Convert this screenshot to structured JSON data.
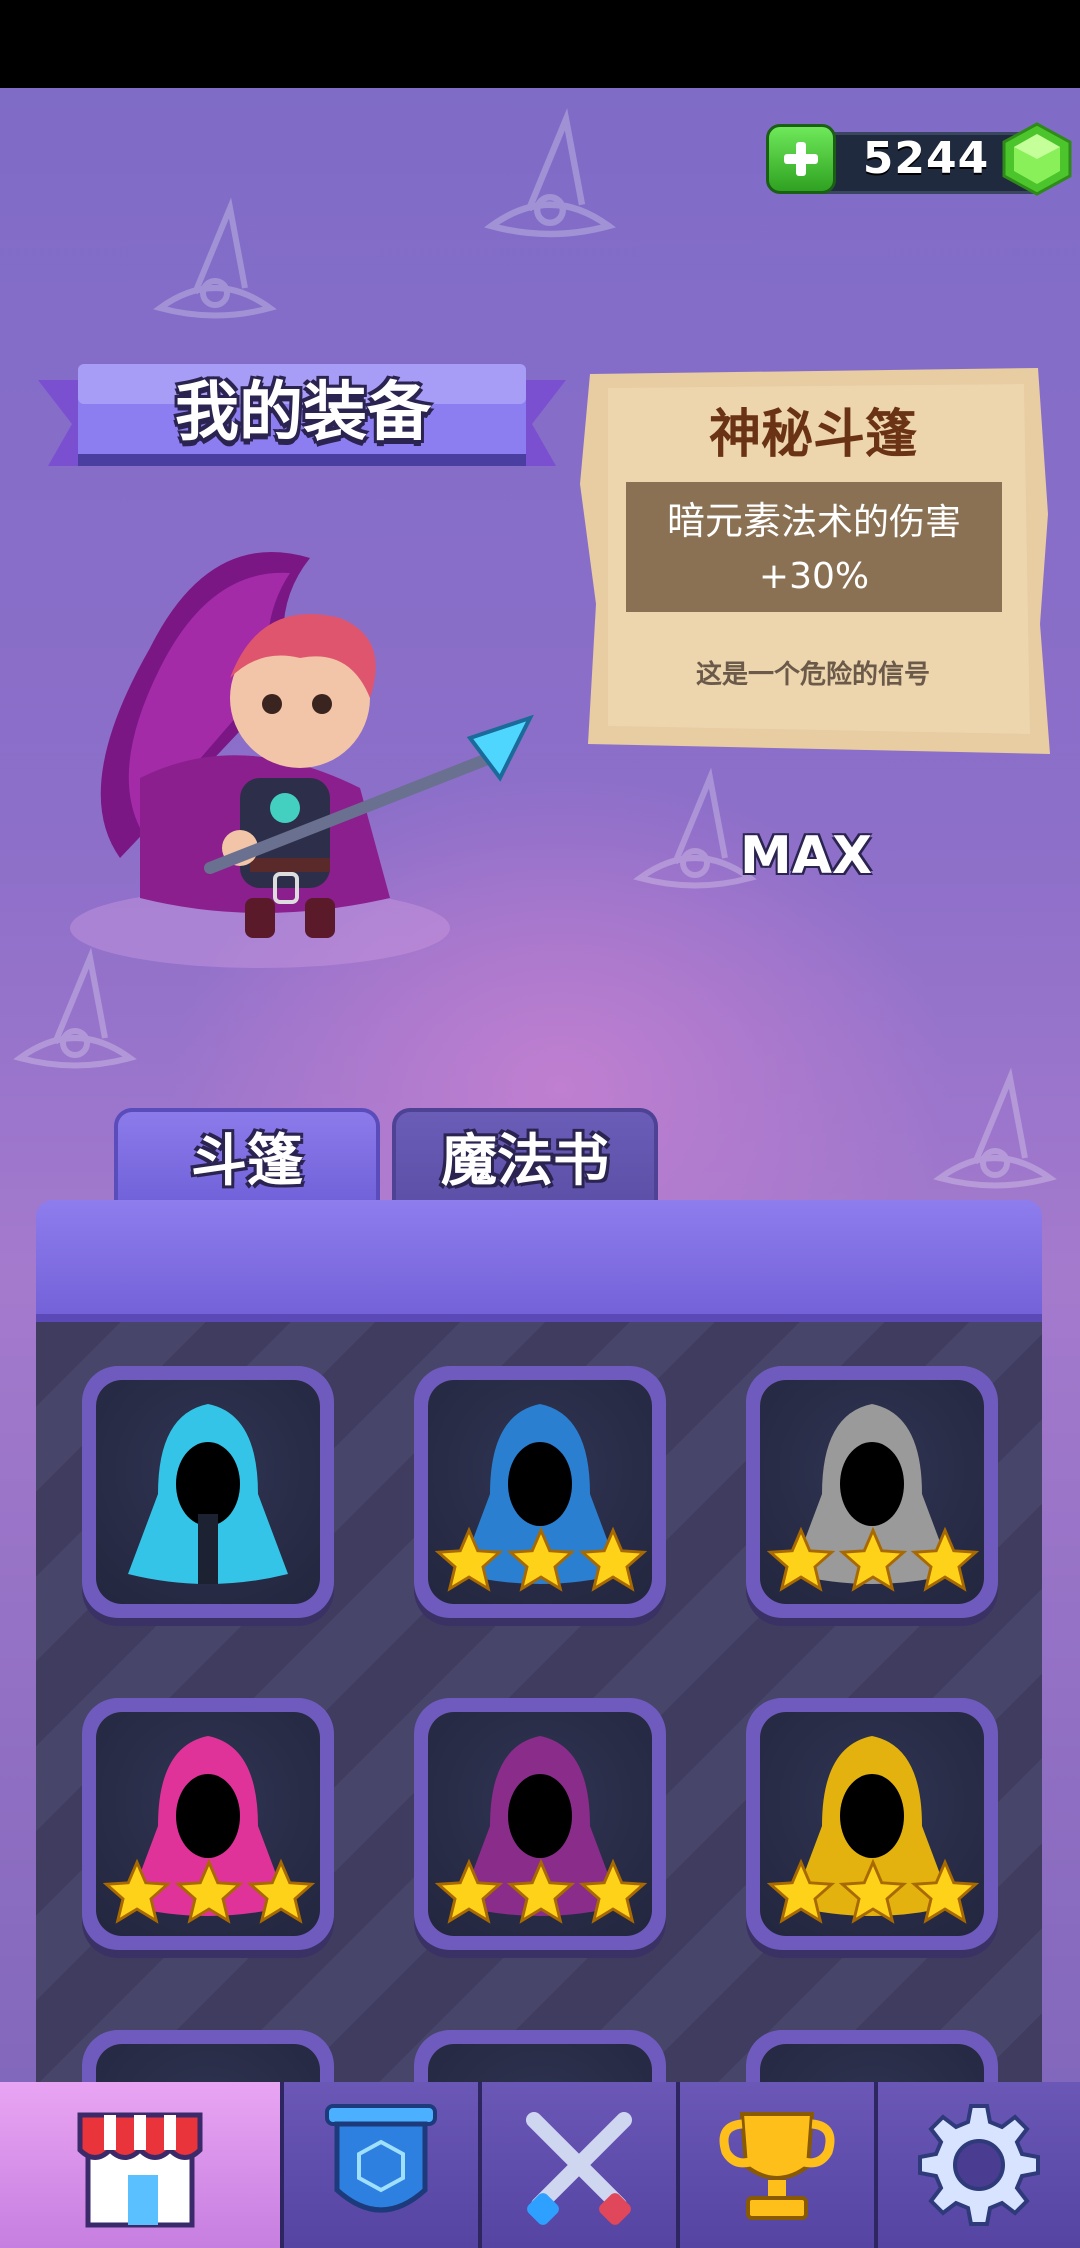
{
  "currency": {
    "gems": "5244"
  },
  "header": {
    "title": "我的装备"
  },
  "selected_item": {
    "name": "神秘斗篷",
    "effect_element": "暗元素",
    "effect_rest": "法术的伤害",
    "effect_value": "+30%",
    "flavor": "这是一个危险的信号",
    "level": "MAX"
  },
  "tabs": [
    {
      "label": "斗篷",
      "active": true
    },
    {
      "label": "魔法书",
      "active": false
    }
  ],
  "items": [
    {
      "color": "#34c4e8",
      "stars": 0
    },
    {
      "color": "#2a7fd0",
      "stars": 3
    },
    {
      "color": "#9a9a9a",
      "stars": 3
    },
    {
      "color": "#e0339a",
      "stars": 3
    },
    {
      "color": "#8a2c8a",
      "stars": 3
    },
    {
      "color": "#e3b20e",
      "stars": 3
    }
  ],
  "nav": [
    "shop-icon",
    "clan-shield-icon",
    "crossed-swords-icon",
    "trophy-icon",
    "gear-icon"
  ],
  "colors": {
    "accent": "#7462d9",
    "gem": "#5ed43a",
    "plus": "#3fbf2e"
  }
}
